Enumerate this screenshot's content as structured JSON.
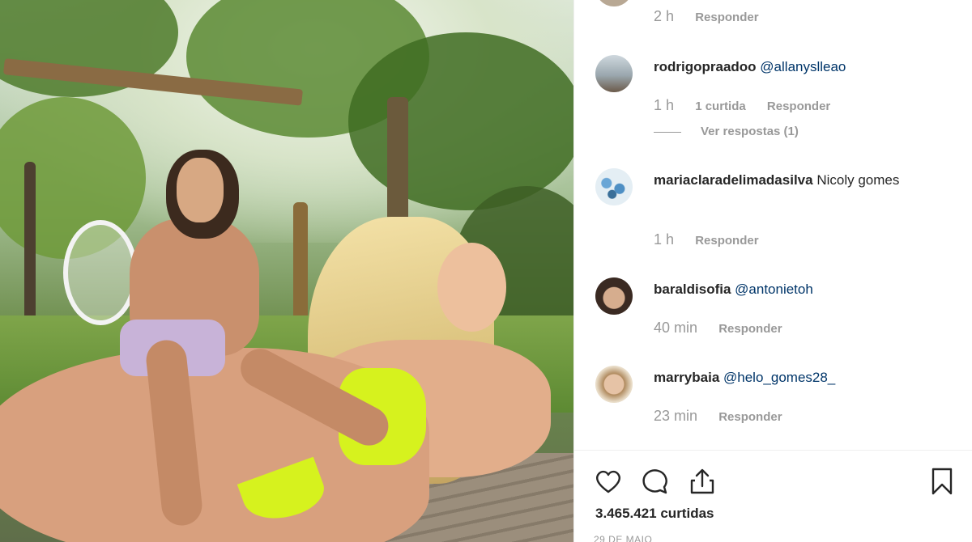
{
  "post": {
    "likes_count": "3.465.421 curtidas",
    "date": "29 DE MAIO"
  },
  "comments": [
    {
      "user": "",
      "text": "",
      "time": "2 h",
      "reply_label": "Responder"
    },
    {
      "user": "rodrigopraadoo",
      "mention": "@allanyslleao",
      "time": "1 h",
      "likes": "1 curtida",
      "reply_label": "Responder",
      "view_replies": "Ver respostas (1)"
    },
    {
      "user": "mariaclaradelimadasilva",
      "text": "Nicoly gomes",
      "time": "1 h",
      "reply_label": "Responder"
    },
    {
      "user": "baraldisofia",
      "mention": "@antonietoh",
      "time": "40 min",
      "reply_label": "Responder"
    },
    {
      "user": "marrybaia",
      "mention": "@helo_gomes28_",
      "time": "23 min",
      "reply_label": "Responder"
    }
  ],
  "icons": {
    "like": "heart-icon",
    "comment": "comment-bubble-icon",
    "share": "share-icon",
    "save": "bookmark-icon"
  },
  "colors": {
    "mention": "#003569",
    "meta": "#999999",
    "text": "#262626",
    "bikini": "#d6f21e"
  }
}
